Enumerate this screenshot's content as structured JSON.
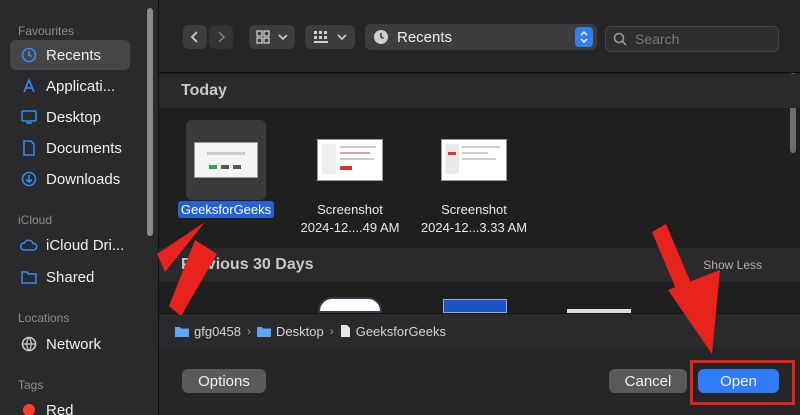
{
  "sidebar": {
    "sections": {
      "favourites": "Favourites",
      "icloud": "iCloud",
      "locations": "Locations",
      "tags": "Tags"
    },
    "items": [
      {
        "label": "Recents",
        "icon": "clock-icon"
      },
      {
        "label": "Applicati...",
        "icon": "applications-icon"
      },
      {
        "label": "Desktop",
        "icon": "desktop-icon"
      },
      {
        "label": "Documents",
        "icon": "document-icon"
      },
      {
        "label": "Downloads",
        "icon": "download-icon"
      },
      {
        "label": "iCloud Dri...",
        "icon": "cloud-icon"
      },
      {
        "label": "Shared",
        "icon": "shared-folder-icon"
      },
      {
        "label": "Network",
        "icon": "globe-icon"
      },
      {
        "label": "Red",
        "icon": "red-tag-icon"
      }
    ]
  },
  "toolbar": {
    "location": "Recents",
    "search_placeholder": "Search"
  },
  "groups": {
    "today": "Today",
    "previous": "Previous 30 Days",
    "show_less": "Show Less"
  },
  "files": [
    {
      "name": "GeeksforGeeks",
      "selected": true
    },
    {
      "name": "Screenshot",
      "sub": "2024-12....49 AM"
    },
    {
      "name": "Screenshot",
      "sub": "2024-12...3.33 AM"
    }
  ],
  "path": [
    "gfg0458",
    "Desktop",
    "GeeksforGeeks"
  ],
  "buttons": {
    "options": "Options",
    "cancel": "Cancel",
    "open": "Open"
  },
  "colors": {
    "accent": "#2e7cf6",
    "annotation": "#e8231c"
  }
}
